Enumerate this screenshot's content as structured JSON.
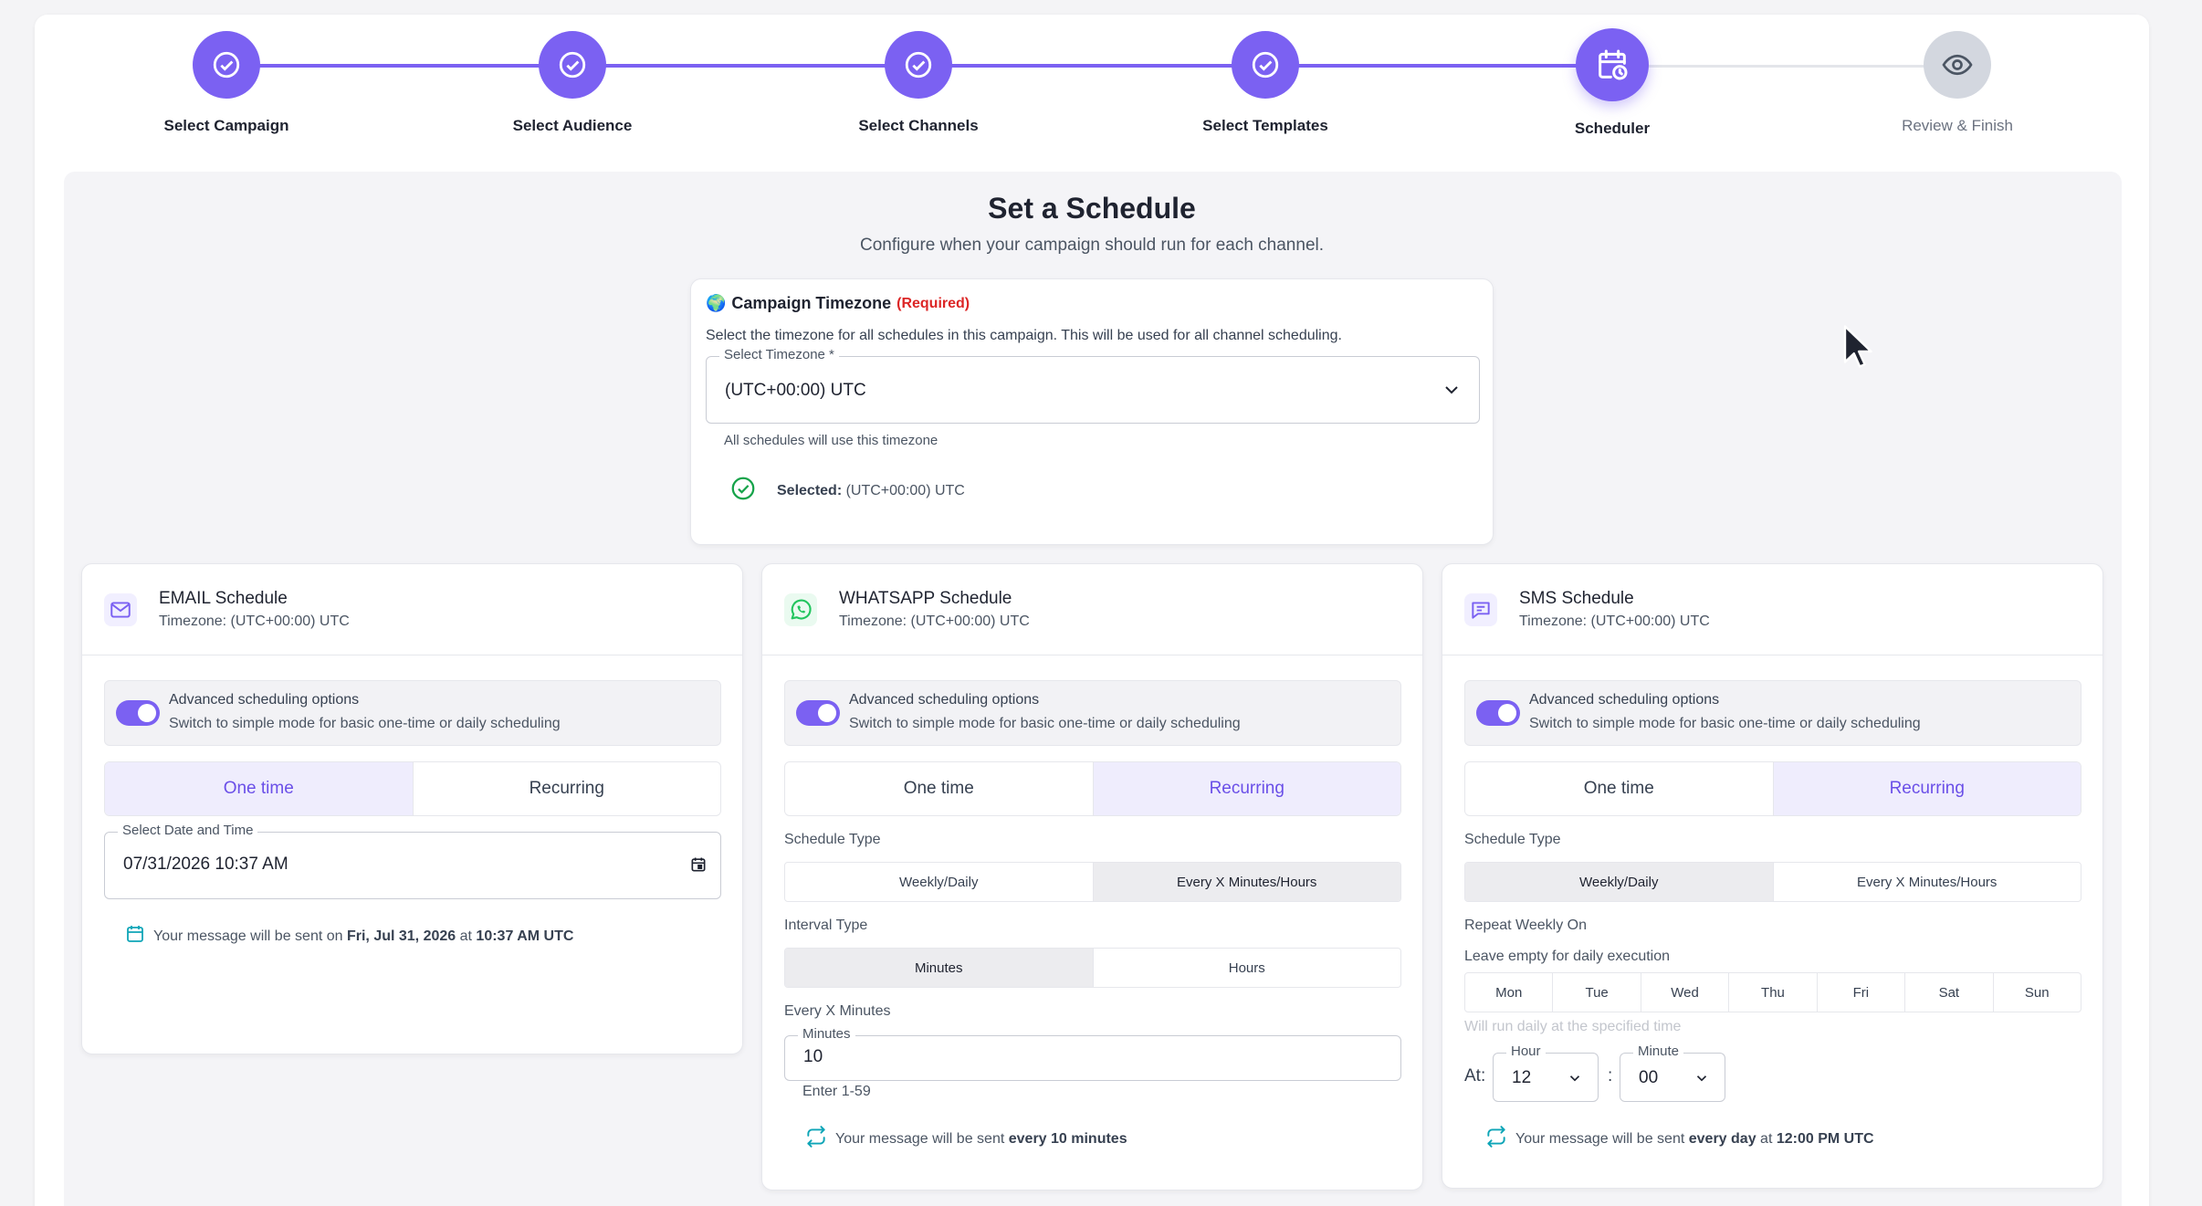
{
  "stepper": {
    "steps": [
      {
        "label": "Select Campaign",
        "status": "completed"
      },
      {
        "label": "Select Audience",
        "status": "completed"
      },
      {
        "label": "Select Channels",
        "status": "completed"
      },
      {
        "label": "Select Templates",
        "status": "completed"
      },
      {
        "label": "Scheduler",
        "status": "active"
      },
      {
        "label": "Review & Finish",
        "status": "pending"
      }
    ]
  },
  "header": {
    "title": "Set a Schedule",
    "subtitle": "Configure when your campaign should run for each channel."
  },
  "timezone": {
    "emoji": "🌍",
    "title": "Campaign Timezone",
    "required": "(Required)",
    "description": "Select the timezone for all schedules in this campaign. This will be used for all channel scheduling.",
    "select_label": "Select Timezone *",
    "select_value": "(UTC+00:00) UTC",
    "helper": "All schedules will use this timezone",
    "selected_label": "Selected:",
    "selected_value": "(UTC+00:00) UTC"
  },
  "email": {
    "title": "EMAIL Schedule",
    "timezone": "Timezone: (UTC+00:00) UTC",
    "adv_title": "Advanced scheduling options",
    "adv_desc": "Switch to simple mode for basic one-time or daily scheduling",
    "tab_one_time": "One time",
    "tab_recurring": "Recurring",
    "selected_tab": "One time",
    "datetime_label": "Select Date and Time",
    "datetime_value": "07/31/2026 10:37 AM",
    "note_prefix": "Your message will be sent on",
    "note_date": "Fri, Jul 31, 2026",
    "note_at": "at",
    "note_time": "10:37 AM UTC"
  },
  "whatsapp": {
    "title": "WHATSAPP Schedule",
    "timezone": "Timezone: (UTC+00:00) UTC",
    "adv_title": "Advanced scheduling options",
    "adv_desc": "Switch to simple mode for basic one-time or daily scheduling",
    "tab_one_time": "One time",
    "tab_recurring": "Recurring",
    "selected_tab": "Recurring",
    "schedule_type_label": "Schedule Type",
    "schedule_type_options": [
      "Weekly/Daily",
      "Every X Minutes/Hours"
    ],
    "schedule_type_selected": "Every X Minutes/Hours",
    "interval_type_label": "Interval Type",
    "interval_options": [
      "Minutes",
      "Hours"
    ],
    "interval_selected": "Minutes",
    "every_x_label": "Every X Minutes",
    "minutes_label": "Minutes",
    "minutes_value": "10",
    "minutes_helper": "Enter 1-59",
    "note_prefix": "Your message will be sent",
    "note_value": "every 10 minutes"
  },
  "sms": {
    "title": "SMS Schedule",
    "timezone": "Timezone: (UTC+00:00) UTC",
    "adv_title": "Advanced scheduling options",
    "adv_desc": "Switch to simple mode for basic one-time or daily scheduling",
    "tab_one_time": "One time",
    "tab_recurring": "Recurring",
    "selected_tab": "Recurring",
    "schedule_type_label": "Schedule Type",
    "schedule_type_options": [
      "Weekly/Daily",
      "Every X Minutes/Hours"
    ],
    "schedule_type_selected": "Weekly/Daily",
    "repeat_label": "Repeat Weekly On",
    "repeat_helper": "Leave empty for daily execution",
    "days": [
      "Mon",
      "Tue",
      "Wed",
      "Thu",
      "Fri",
      "Sat",
      "Sun"
    ],
    "daily_hint": "Will run daily at the specified time",
    "at_label": "At:",
    "hour_label": "Hour",
    "hour_value": "12",
    "colon": ":",
    "minute_label": "Minute",
    "minute_value": "00",
    "note_prefix": "Your message will be sent",
    "note_freq": "every day",
    "note_at": "at",
    "note_time": "12:00 PM UTC"
  },
  "colors": {
    "accent": "#7b61f2",
    "accent_light": "#efedfd",
    "required": "#dc2626",
    "success": "#16a34a",
    "email_icon": "#7b61f2",
    "whatsapp_icon": "#22c55e",
    "sms_icon": "#7b61f2",
    "info_icon": "#0ea5b7"
  }
}
